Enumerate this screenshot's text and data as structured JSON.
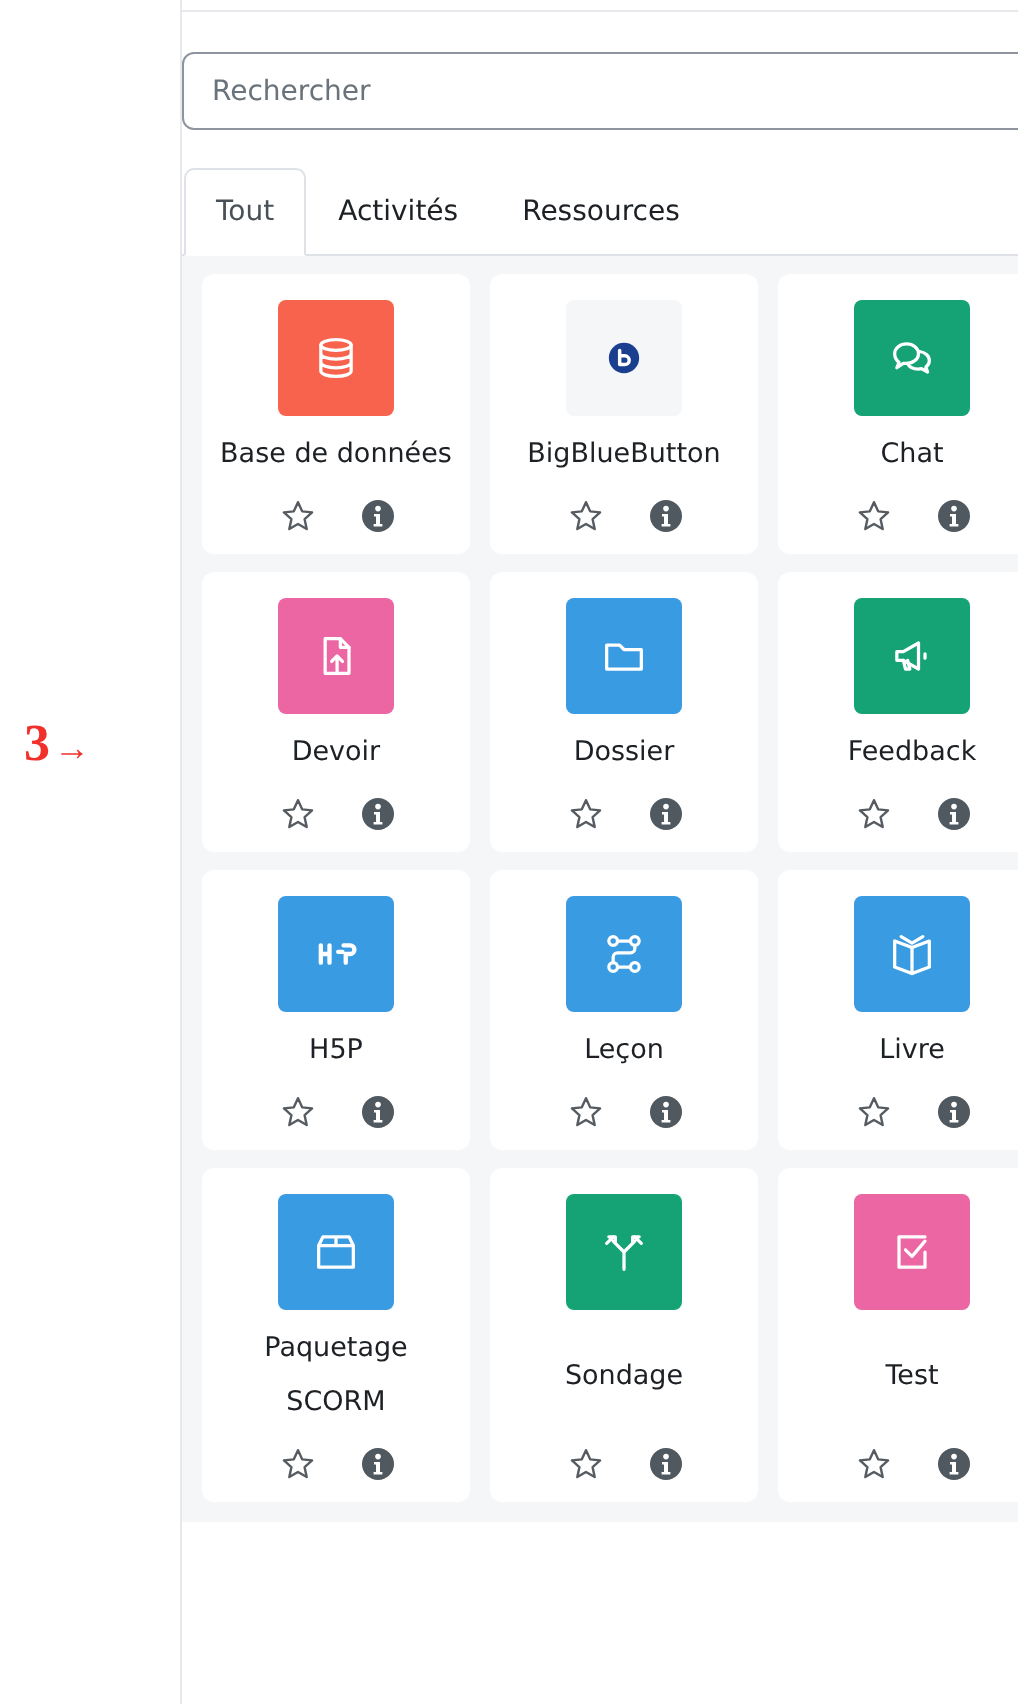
{
  "annotation": {
    "number": "3",
    "arrow": "→"
  },
  "search": {
    "placeholder": "Rechercher"
  },
  "tabs": [
    {
      "label": "Tout",
      "selected": true
    },
    {
      "label": "Activités",
      "selected": false
    },
    {
      "label": "Ressources",
      "selected": false
    }
  ],
  "activities": [
    {
      "name": "Base de données",
      "kind": "database",
      "color": "#f7634d"
    },
    {
      "name": "BigBlueButton",
      "kind": "bigbluebutton",
      "color": "#f5f6f8"
    },
    {
      "name": "Chat",
      "kind": "chat",
      "color": "#15a375"
    },
    {
      "name": "Devoir",
      "kind": "assignment",
      "color": "#eb66a2"
    },
    {
      "name": "Dossier",
      "kind": "folder",
      "color": "#399be2"
    },
    {
      "name": "Feedback",
      "kind": "feedback",
      "color": "#15a375"
    },
    {
      "name": "H5P",
      "kind": "h5p",
      "color": "#399be2"
    },
    {
      "name": "Leçon",
      "kind": "lesson",
      "color": "#399be2"
    },
    {
      "name": "Livre",
      "kind": "book",
      "color": "#399be2"
    },
    {
      "name": "Paquetage SCORM",
      "kind": "package",
      "color": "#399be2"
    },
    {
      "name": "Sondage",
      "kind": "choice",
      "color": "#15a375"
    },
    {
      "name": "Test",
      "kind": "quiz",
      "color": "#eb66a2"
    }
  ]
}
